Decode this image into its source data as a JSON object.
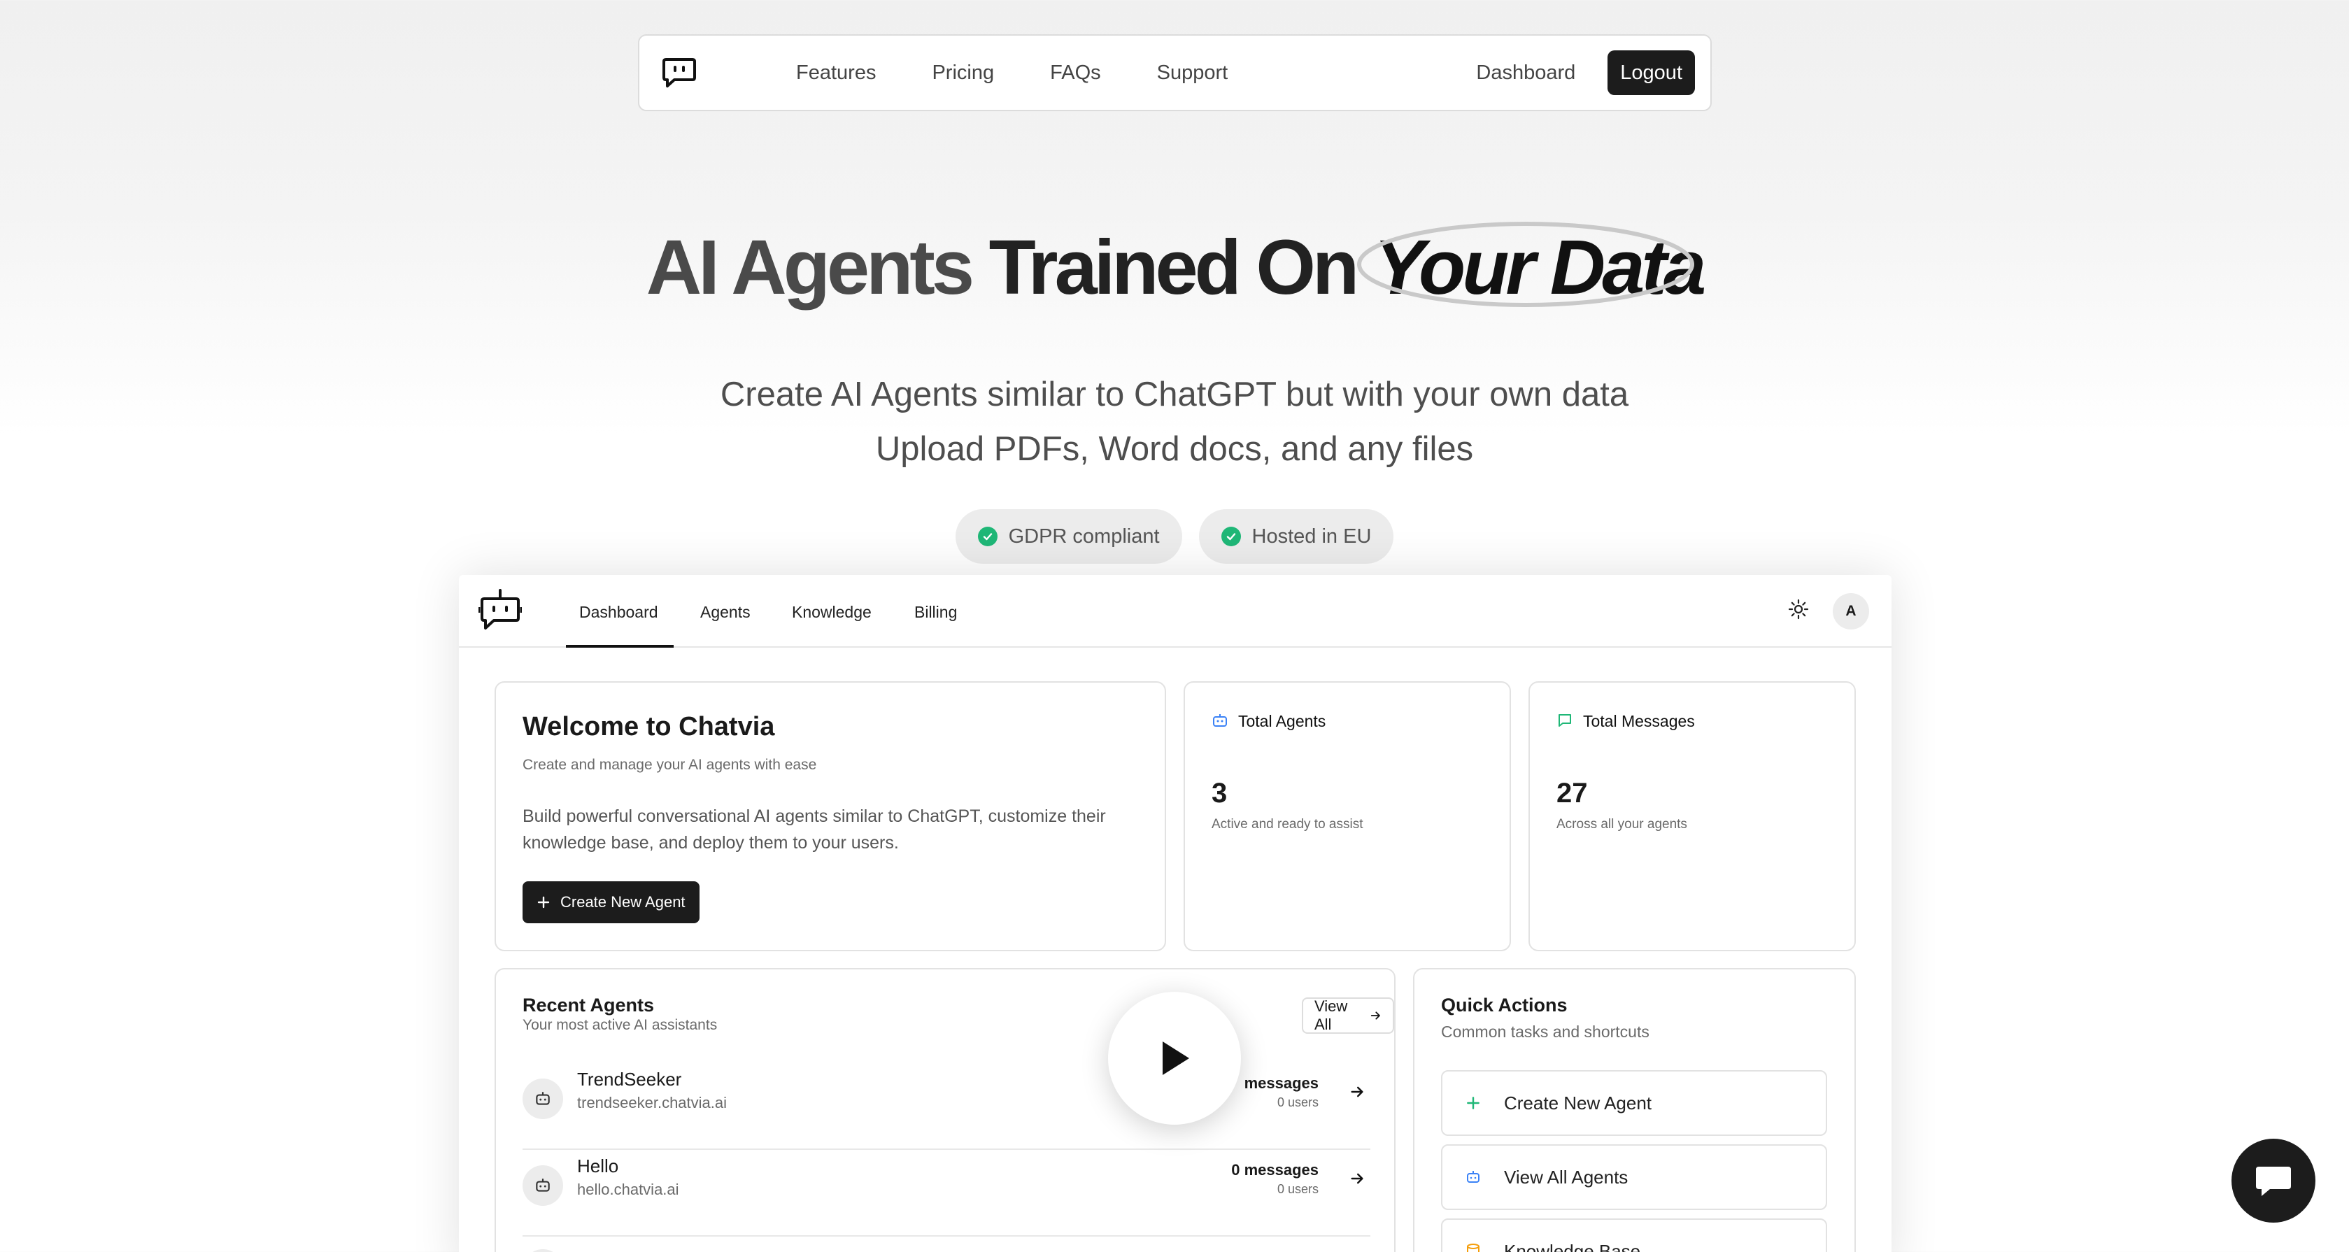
{
  "topnav": {
    "links": [
      "Features",
      "Pricing",
      "FAQs",
      "Support"
    ],
    "dashboard": "Dashboard",
    "logout": "Logout"
  },
  "hero": {
    "title_part1": "AI Agents",
    "title_part2": "Trained On",
    "title_highlight": "Your Data",
    "subtitle_line1": "Create AI Agents similar to ChatGPT but with your own data",
    "subtitle_line2": "Upload PDFs, Word docs, and any files",
    "badges": [
      "GDPR compliant",
      "Hosted in EU"
    ]
  },
  "app": {
    "tabs": [
      "Dashboard",
      "Agents",
      "Knowledge",
      "Billing"
    ],
    "avatar_initial": "A",
    "welcome": {
      "title": "Welcome to Chatvia",
      "subtitle": "Create and manage your AI agents with ease",
      "body": "Build powerful conversational AI agents similar to ChatGPT, customize their knowledge base, and deploy them to your users.",
      "button": "Create New Agent"
    },
    "stats": [
      {
        "label": "Total Agents",
        "value": "3",
        "caption": "Active and ready to assist",
        "icon": "bot-icon",
        "color": "#3b82f6"
      },
      {
        "label": "Total Messages",
        "value": "27",
        "caption": "Across all your agents",
        "icon": "message-icon",
        "color": "#1fb777"
      }
    ],
    "recent": {
      "title": "Recent Agents",
      "subtitle": "Your most active AI assistants",
      "view_all": "View All",
      "agents": [
        {
          "name": "TrendSeeker",
          "domain": "trendseeker.chatvia.ai",
          "messages": "messages",
          "users": "0 users"
        },
        {
          "name": "Hello",
          "domain": "hello.chatvia.ai",
          "messages": "0 messages",
          "users": "0 users"
        }
      ]
    },
    "quick": {
      "title": "Quick Actions",
      "subtitle": "Common tasks and shortcuts",
      "items": [
        {
          "label": "Create New Agent",
          "icon": "plus-icon"
        },
        {
          "label": "View All Agents",
          "icon": "bot-icon"
        },
        {
          "label": "Knowledge Base",
          "icon": "database-icon"
        }
      ]
    }
  }
}
